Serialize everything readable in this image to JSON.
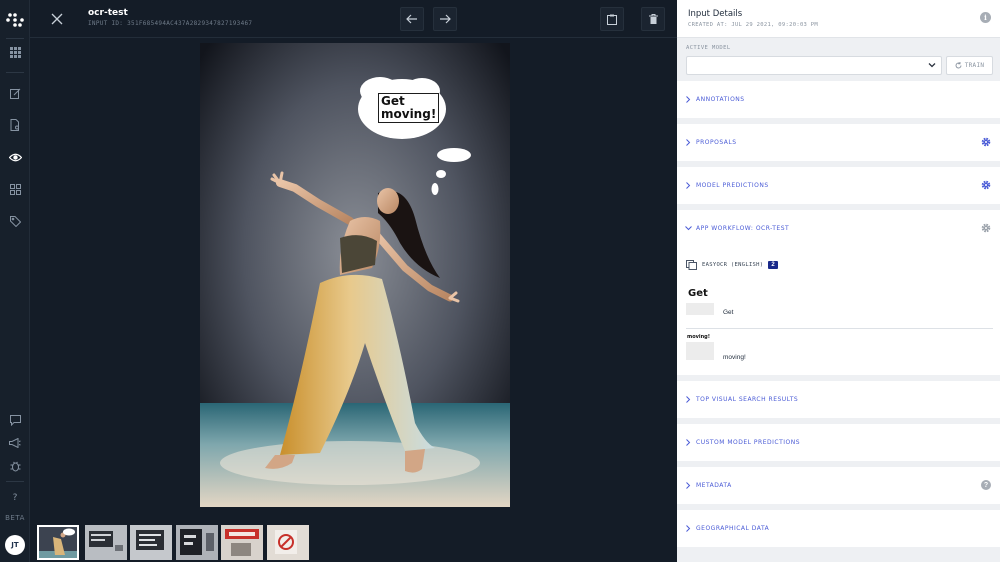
{
  "header": {
    "title": "ocr-test",
    "input_id": "INPUT ID: 351F685494AC437A2829347827193467"
  },
  "nav": {
    "beta_label": "BETA",
    "user_initials": "JT"
  },
  "canvas": {
    "annotation_text_line1": "Get",
    "annotation_text_line2": "moving!"
  },
  "thumbnails_count": 6,
  "panel": {
    "title": "Input Details",
    "created": "CREATED AT: JUL 29 2021, 09:20:03 PM",
    "active_model_label": "ACTIVE MODEL",
    "active_model_value": "",
    "train_label": "TRAIN",
    "sections": {
      "annotations": "ANNOTATIONS",
      "proposals": "PROPOSALS",
      "model_predictions": "MODEL PREDICTIONS",
      "app_workflow": "APP WORKFLOW: OCR-TEST",
      "top_visual": "TOP VISUAL SEARCH RESULTS",
      "custom_model": "CUSTOM MODEL PREDICTIONS",
      "metadata": "METADATA",
      "geo": "GEOGRAPHICAL DATA"
    },
    "workflow": {
      "model_name": "EASYOCR (ENGLISH)",
      "result_count": "2",
      "results": [
        {
          "crop_text": "Get",
          "text": "Get"
        },
        {
          "crop_text": "moving!",
          "text": "moving!"
        }
      ]
    }
  },
  "colors": {
    "accent": "#4a5bd6",
    "dark_bg": "#141c27",
    "panel_bg": "#eef0f3",
    "count_badge": "#1a2a8a"
  }
}
